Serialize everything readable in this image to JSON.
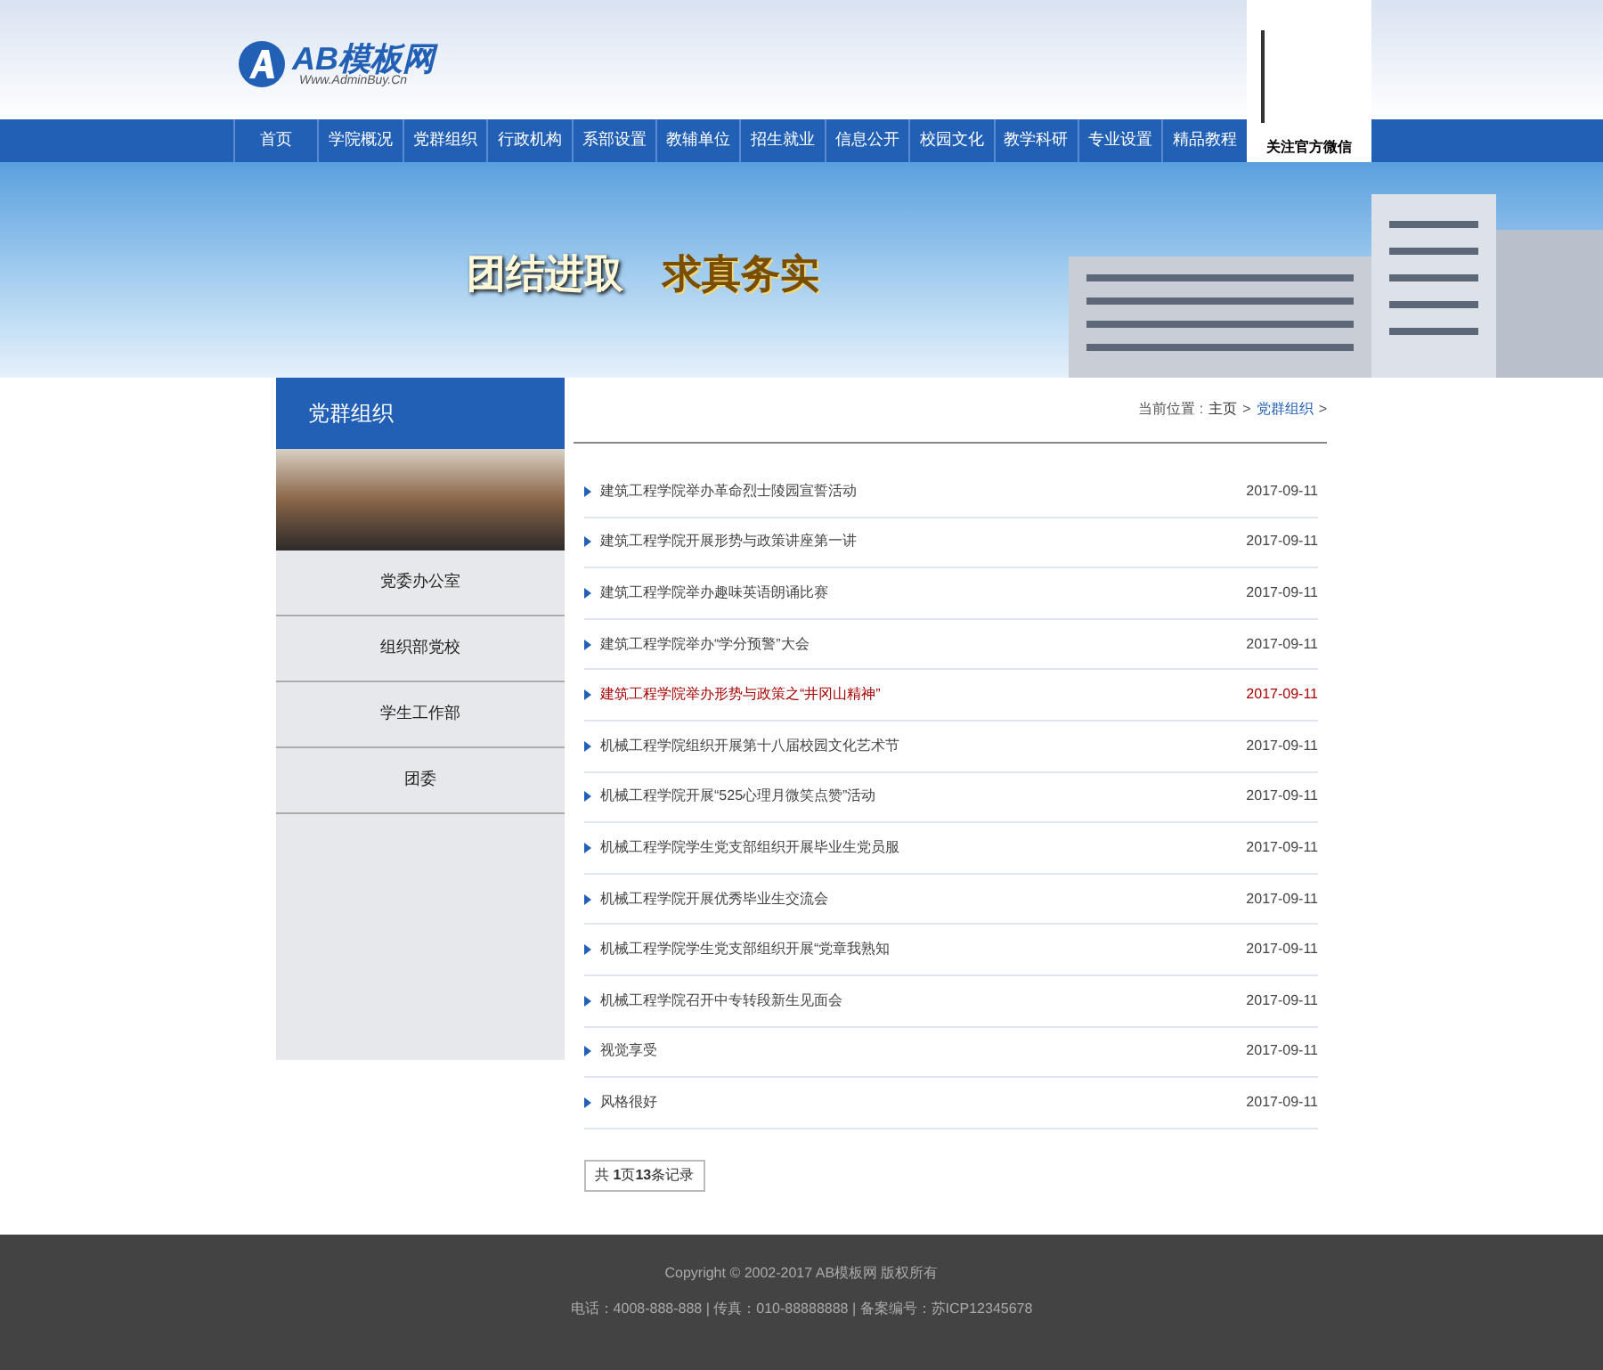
{
  "header": {
    "logo_text": "AB模板网",
    "logo_url": "Www.AdminBuy.Cn",
    "wechat_label": "关注官方微信"
  },
  "nav": [
    {
      "label": "首页",
      "selected": false
    },
    {
      "label": "学院概况",
      "selected": false
    },
    {
      "label": "党群组织",
      "selected": false
    },
    {
      "label": "行政机构",
      "selected": false
    },
    {
      "label": "系部设置",
      "selected": false
    },
    {
      "label": "教辅单位",
      "selected": false
    },
    {
      "label": "招生就业",
      "selected": false
    },
    {
      "label": "信息公开",
      "selected": false
    },
    {
      "label": "校园文化",
      "selected": false
    },
    {
      "label": "教学科研",
      "selected": false
    },
    {
      "label": "专业设置",
      "selected": false
    },
    {
      "label": "精品教程",
      "selected": false
    }
  ],
  "banner": {
    "slogan_1": "团结进取",
    "slogan_2": "求真务实"
  },
  "sidebar": {
    "title": "党群组织",
    "items": [
      "党委办公室",
      "组织部党校",
      "学生工作部",
      "团委"
    ]
  },
  "breadcrumb": {
    "label": "当前位置 :",
    "home": "主页",
    "sep_1": ">",
    "current": "党群组织",
    "sep_2": ">"
  },
  "articles": [
    {
      "title": "建筑工程学院举办革命烈士陵园宣誓活动",
      "date": "2017-09-11",
      "selected": false
    },
    {
      "title": "建筑工程学院开展形势与政策讲座第一讲",
      "date": "2017-09-11",
      "selected": false
    },
    {
      "title": "建筑工程学院举办趣味英语朗诵比赛",
      "date": "2017-09-11",
      "selected": false
    },
    {
      "title": "建筑工程学院举办“学分预警”大会",
      "date": "2017-09-11",
      "selected": false
    },
    {
      "title": "建筑工程学院举办形势与政策之“井冈山精神”",
      "date": "2017-09-11",
      "selected": true
    },
    {
      "title": "机械工程学院组织开展第十八届校园文化艺术节",
      "date": "2017-09-11",
      "selected": false
    },
    {
      "title": "机械工程学院开展“525心理月微笑点赞”活动",
      "date": "2017-09-11",
      "selected": false
    },
    {
      "title": "机械工程学院学生党支部组织开展毕业生党员服",
      "date": "2017-09-11",
      "selected": false
    },
    {
      "title": "机械工程学院开展优秀毕业生交流会",
      "date": "2017-09-11",
      "selected": false
    },
    {
      "title": "机械工程学院学生党支部组织开展“党章我熟知",
      "date": "2017-09-11",
      "selected": false
    },
    {
      "title": "机械工程学院召开中专转段新生见面会",
      "date": "2017-09-11",
      "selected": false
    },
    {
      "title": "视觉享受",
      "date": "2017-09-11",
      "selected": false
    },
    {
      "title": "风格很好",
      "date": "2017-09-11",
      "selected": false
    }
  ],
  "pager": "共 **1**页**13**条记录",
  "footer": {
    "copyright": "Copyright © 2002-2017 AB模板网 版权所有",
    "contact": "电话：4008-888-888 | 传真：010-88888888 | 备案编号：苏ICP12345678"
  }
}
